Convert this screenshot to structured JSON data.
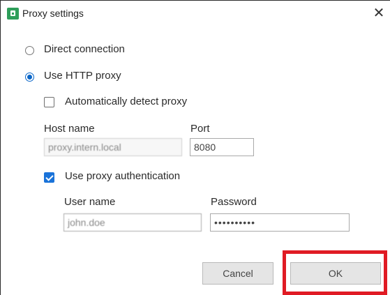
{
  "window": {
    "title": "Proxy settings",
    "close_glyph": "✕",
    "icon": "proxy-app-icon"
  },
  "connection": {
    "direct_label": "Direct connection",
    "direct_selected": false,
    "http_label": "Use HTTP proxy",
    "http_selected": true
  },
  "auto_detect": {
    "label": "Automatically detect proxy",
    "checked": false
  },
  "host": {
    "label": "Host name",
    "value": "proxy.intern.local"
  },
  "port": {
    "label": "Port",
    "value": "8080"
  },
  "auth": {
    "label": "Use proxy authentication",
    "checked": true
  },
  "username": {
    "label": "User name",
    "value": "john.doe"
  },
  "password": {
    "label": "Password",
    "value": "••••••••••"
  },
  "buttons": {
    "cancel_label": "Cancel",
    "ok_label": "OK"
  },
  "colors": {
    "accent": "#1a73d9",
    "highlight": "#e01b24",
    "app_icon": "#2e9e5a"
  }
}
